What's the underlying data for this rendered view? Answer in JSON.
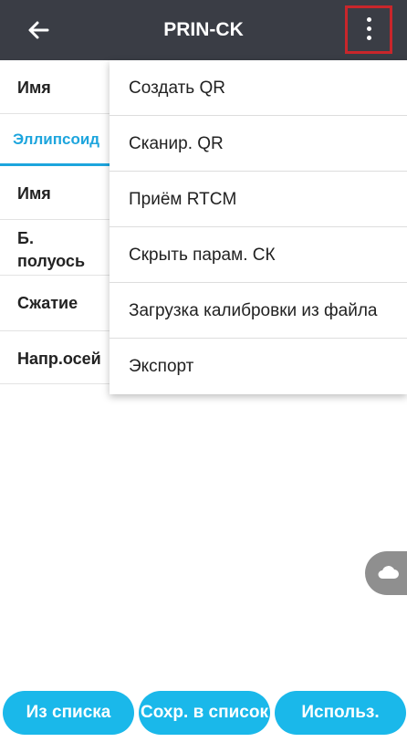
{
  "header": {
    "title": "PRIN-CK"
  },
  "rows": {
    "name1": "Имя",
    "tab_ellipsoid": "Эллипсоид",
    "name2": "Имя",
    "semi_axis_line1": "Б.",
    "semi_axis_line2": "полуось",
    "flattening": "Сжатие",
    "axis_direction": "Напр.осей"
  },
  "menu": {
    "items": [
      "Создать QR",
      "Сканир. QR",
      "Приём RTCM",
      "Скрыть парам. СК",
      "Загрузка калибровки из файла",
      "Экспорт"
    ]
  },
  "buttons": {
    "from_list": "Из списка",
    "save_to_list": "Сохр. в список",
    "use": "Использ."
  },
  "colors": {
    "appbar": "#3a3d45",
    "accent": "#1ab8ea",
    "highlight": "#c9262b"
  }
}
